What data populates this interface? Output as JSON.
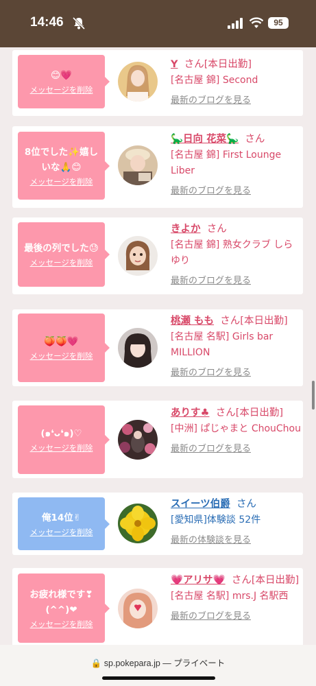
{
  "status_bar": {
    "time": "14:46",
    "battery": "95"
  },
  "url_bar": {
    "text": "sp.pokepara.jp — プライベート"
  },
  "delete_label": "メッセージを削除",
  "cards": [
    {
      "message": "😊💗",
      "name": "Y",
      "san": "さん",
      "attendance": "[本日出勤]",
      "shop": "[名古屋 錦] Second",
      "blog": "最新のブログを見る"
    },
    {
      "message": "8位でした✨嬉しいな🙏😊",
      "name": "🦕日向 花菜🦕",
      "san": "さん",
      "attendance": "",
      "shop": "[名古屋 錦] First Lounge Liber",
      "blog": "最新のブログを見る"
    },
    {
      "message": "最後の列でした😓",
      "name": "きよか",
      "san": "さん",
      "attendance": "",
      "shop": "[名古屋 錦] 熟女クラブ しらゆり",
      "blog": "最新のブログを見る"
    },
    {
      "message": "🍑🍑💗",
      "name": "桃瀬 もも",
      "san": "さん",
      "attendance": "[本日出勤]",
      "shop": "[名古屋 名駅] Girls bar MILLION",
      "blog": "最新のブログを見る"
    },
    {
      "message": "(๑❛ᴗ❛๑)♡",
      "name": "ありす♣",
      "san": "さん",
      "attendance": "[本日出勤]",
      "shop": "[中洲] ぱじゃまと ChouChou",
      "blog": "最新のブログを見る"
    },
    {
      "message": "俺14位✌",
      "name": "スイーツ伯爵",
      "san": "さん",
      "attendance": "",
      "shop": "[愛知県]体験談 52件",
      "blog": "最新の体験談を見る"
    },
    {
      "message": "お疲れ様です❣(^^)❤",
      "name": "💗アリサ💗",
      "san": "さん",
      "attendance": "[本日出勤]",
      "shop": "[名古屋 名駅] mrs.J 名駅西",
      "blog": "最新のブログを見る"
    }
  ]
}
